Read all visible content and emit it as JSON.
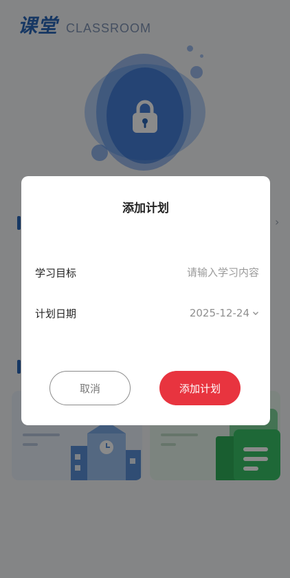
{
  "header": {
    "brand_cn": "课堂",
    "brand_en": "CLASSROOM"
  },
  "background": {
    "section_arrow": "›"
  },
  "modal": {
    "title": "添加计划",
    "goal_label": "学习目标",
    "goal_placeholder": "请输入学习内容",
    "goal_value": "",
    "date_label": "计划日期",
    "date_value": "2025-12-24",
    "cancel_label": "取消",
    "confirm_label": "添加计划"
  },
  "colors": {
    "brand_blue": "#2a67b8",
    "accent_red": "#e8343f",
    "overlay": "rgba(0,0,0,0.46)"
  },
  "icons": {
    "hero": "lock-icon",
    "date_select": "chevron-down-icon",
    "section_more": "chevron-right-icon",
    "card_left": "school-building-icon",
    "card_right": "notebook-icon"
  }
}
